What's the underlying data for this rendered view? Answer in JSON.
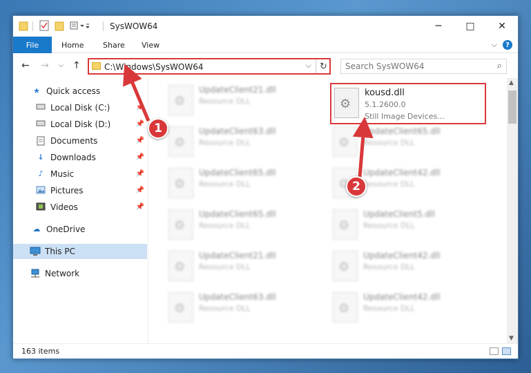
{
  "window": {
    "title": "SysWOW64",
    "minimize_icon": "minimize-icon",
    "maximize_icon": "maximize-icon",
    "close_icon": "close-icon"
  },
  "ribbon": {
    "tabs": [
      "File",
      "Home",
      "Share",
      "View"
    ],
    "help": "?"
  },
  "navbar": {
    "address": "C:\\Windows\\SysWOW64",
    "search_placeholder": "Search SysWOW64"
  },
  "sidebar": {
    "items": [
      {
        "label": "Quick access",
        "icon": "star-icon"
      },
      {
        "label": "Local Disk (C:)",
        "icon": "drive-icon",
        "pinned": true
      },
      {
        "label": "Local Disk (D:)",
        "icon": "drive-icon",
        "pinned": true
      },
      {
        "label": "Documents",
        "icon": "documents-icon",
        "pinned": true
      },
      {
        "label": "Downloads",
        "icon": "download-icon",
        "pinned": true
      },
      {
        "label": "Music",
        "icon": "music-icon",
        "pinned": true
      },
      {
        "label": "Pictures",
        "icon": "pictures-icon",
        "pinned": true
      },
      {
        "label": "Videos",
        "icon": "videos-icon",
        "pinned": true
      },
      {
        "label": "OneDrive",
        "icon": "cloud-icon"
      },
      {
        "label": "This PC",
        "icon": "computer-icon",
        "selected": true
      },
      {
        "label": "Network",
        "icon": "network-icon"
      }
    ]
  },
  "files": {
    "highlighted": {
      "name": "kousd.dll",
      "version": "5.1.2600.0",
      "description": "Still Image Devices..."
    },
    "left_column": [
      {
        "name": "UpdateClient21.dll",
        "type": "Resource DLL"
      },
      {
        "name": "UpdateClient63.dll",
        "type": "Resource DLL"
      },
      {
        "name": "UpdateClient65.dll",
        "type": "Resource DLL"
      },
      {
        "name": "UpdateClient65.dll",
        "type": "Resource DLL"
      },
      {
        "name": "UpdateClient21.dll",
        "type": "Resource DLL"
      },
      {
        "name": "UpdateClient63.dll",
        "type": "Resource DLL"
      }
    ],
    "right_column": [
      {
        "name": "UpdateClient65.dll",
        "type": "Resource DLL"
      },
      {
        "name": "UpdateClient42.dll",
        "type": "Resource DLL"
      },
      {
        "name": "UpdateClient5.dll",
        "type": "Resource DLL"
      },
      {
        "name": "UpdateClient42.dll",
        "type": "Resource DLL"
      },
      {
        "name": "UpdateClient42.dll",
        "type": "Resource DLL"
      }
    ]
  },
  "status": {
    "items_count": "163 items"
  },
  "callouts": [
    "1",
    "2"
  ],
  "colors": {
    "accent": "#1979ca",
    "highlight": "#d9383a",
    "selected": "#cce0f5"
  }
}
